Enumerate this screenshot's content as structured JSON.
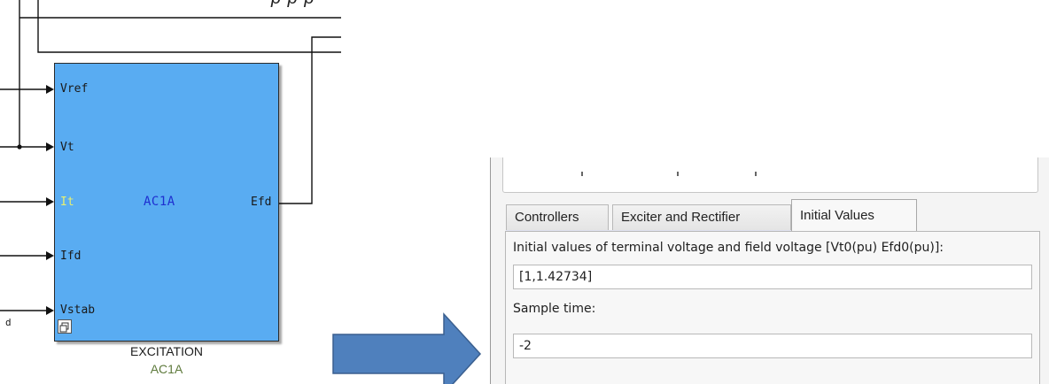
{
  "cut_caption": "p   p   p",
  "block": {
    "title": "AC1A",
    "ports_in": [
      "Vref",
      "Vt",
      "It",
      "Ifd",
      "Vstab"
    ],
    "port_out": "Efd",
    "caption": "EXCITATION",
    "subcaption": "AC1A",
    "stray_label": "d",
    "colors": {
      "body": "#59acf2",
      "title": "#1e2fd0",
      "it_port": "#e8f070",
      "subcaption": "#5e7a3c"
    }
  },
  "arrow": {
    "color": "#4f80bd",
    "icon": "right-arrow-icon"
  },
  "dialog": {
    "tabs": [
      "Controllers",
      "Exciter and Rectifier",
      "Initial Values"
    ],
    "active_tab": "Initial Values",
    "fields": [
      {
        "label": "Initial values of terminal voltage and field voltage [Vt0(pu) Efd0(pu)]:",
        "value": "[1,1.42734]"
      },
      {
        "label": "Sample time:",
        "value": "-2"
      }
    ]
  }
}
